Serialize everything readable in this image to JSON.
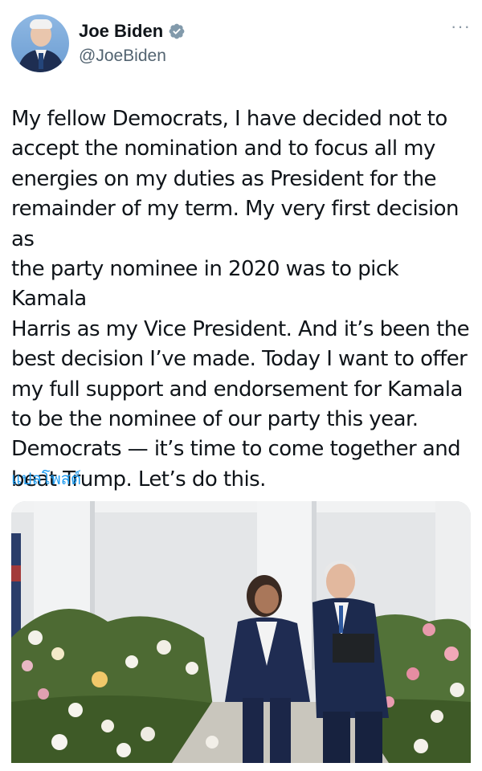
{
  "author": {
    "display_name": "Joe Biden",
    "handle": "@JoeBiden",
    "verified_icon": "verified-badge-icon",
    "avatar": "avatar-photo"
  },
  "menu": {
    "more_icon": "more-options-icon",
    "more_glyph": "···"
  },
  "tweet": {
    "text": "My fellow Democrats, I have decided not to\naccept the nomination and to focus all my\nenergies on my duties as President for the\nremainder of my term. My very first decision as\nthe party nominee in 2020 was to pick Kamala\nHarris as my Vice President. And it’s been the\nbest decision I’ve made. Today I want to offer\nmy full support and endorsement for Kamala\nto be the nominee of our party this year.\nDemocrats — it’s time to come together and\nbeat Trump. Let’s do this.",
    "translate_label": "แปลโพสต์"
  },
  "media": {
    "type": "photo",
    "icon": "attached-photo"
  },
  "colors": {
    "link": "#1d9bf0",
    "secondary_text": "#536471",
    "verified": "#829aab"
  }
}
